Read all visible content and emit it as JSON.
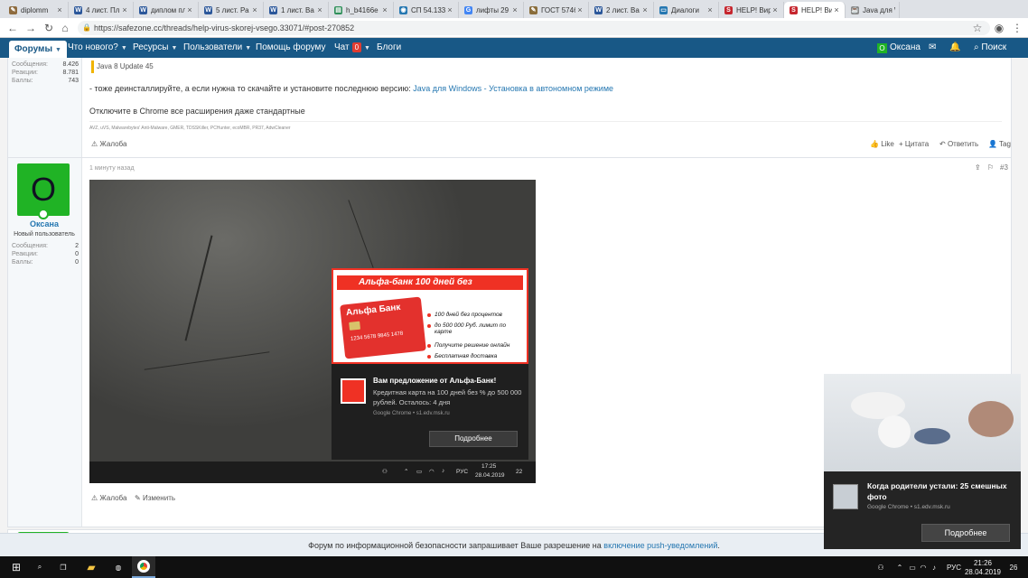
{
  "tabs": [
    {
      "title": "diplomm"
    },
    {
      "title": "4 лист. Пл"
    },
    {
      "title": "диплом пл"
    },
    {
      "title": "5 лист. Ра"
    },
    {
      "title": "1 лист. Ва"
    },
    {
      "title": "h_b4166e"
    },
    {
      "title": "СП 54.133"
    },
    {
      "title": "лифты 29"
    },
    {
      "title": "ГОСТ 5746"
    },
    {
      "title": "2 лист. Ва"
    },
    {
      "title": "Диалоги"
    },
    {
      "title": "HELP! Виру"
    },
    {
      "title": "HELP! Вир"
    },
    {
      "title": "Java для W"
    }
  ],
  "address": {
    "url": "https://safezone.cc/threads/help-virus-skorej-vsego.33071/#post-270852"
  },
  "forum_nav": {
    "forums": "Форумы",
    "whats_new": "Что нового?",
    "resources": "Ресурсы",
    "users": "Пользователи",
    "help": "Помощь форуму",
    "chat": "Чат",
    "chat_count": "0",
    "blogs": "Блоги",
    "user_initial": "О",
    "user": "Оксана",
    "search": "Поиск"
  },
  "post1": {
    "stats": [
      {
        "label": "Сообщения:",
        "value": "8.426"
      },
      {
        "label": "Реакции:",
        "value": "8.781"
      },
      {
        "label": "Баллы:",
        "value": "743"
      }
    ],
    "quote": "Java 8 Update 45",
    "line1_prefix": "- тоже деинсталлируйте, а если нужна то скачайте и установите последнюю версию:",
    "line1_link": "Java для Windows - Установка в автономном режиме",
    "line2": "Отключите в Chrome все расширения даже стандартные",
    "signature": "AVZ, uVS, Malwarebytes' Anti-Malware, GMER, TDSSKiller, PCHunter, ecoMBR, PR37, AdwCleaner",
    "report": "Жалоба",
    "like": "Like",
    "quote_btn": "Цитата",
    "reply": "Ответить",
    "tag": "Tag"
  },
  "post2": {
    "time": "1 минуту назад",
    "number": "#3",
    "avatar_letter": "О",
    "username": "Оксана",
    "user_title": "Новый пользователь",
    "stats": [
      {
        "label": "Сообщения:",
        "value": "2"
      },
      {
        "label": "Реакции:",
        "value": "0"
      },
      {
        "label": "Баллы:",
        "value": "0"
      }
    ],
    "report": "Жалоба",
    "edit": "Изменить"
  },
  "screenshot": {
    "promo_title": "Альфа-банк 100 дней без процентов",
    "card_bank": "Альфа Банк",
    "card_number": "1234 5678 9845 1478",
    "bullets": [
      "100 дней без процентов",
      "до 500 000 Руб. лимит по карте",
      "Получите решение онлайн",
      "Бесплатная доставка"
    ],
    "notif_title": "Вам предложение от Альфа-Банк!",
    "notif_body": "Кредитная карта на 100 дней без % до 500 000 рублей. Осталось: 4 дня",
    "notif_source": "Google Chrome • s1.edv.msk.ru",
    "notif_button": "Подробнее",
    "lang": "РУС",
    "time": "17:25",
    "date": "28.04.2019",
    "notif_count": "22"
  },
  "popup": {
    "title": "Когда родители устали: 25 смешных фото",
    "source": "Google Chrome • s1.edv.msk.ru",
    "button": "Подробнее"
  },
  "push_bar": {
    "text": "Форум по информационной безопасности запрашивает Ваше разрешение на",
    "link": "включение push-уведомлений",
    "tail": "."
  },
  "taskbar": {
    "lang": "РУС",
    "time": "21:26",
    "date": "28.04.2019",
    "notif_count": "26"
  }
}
